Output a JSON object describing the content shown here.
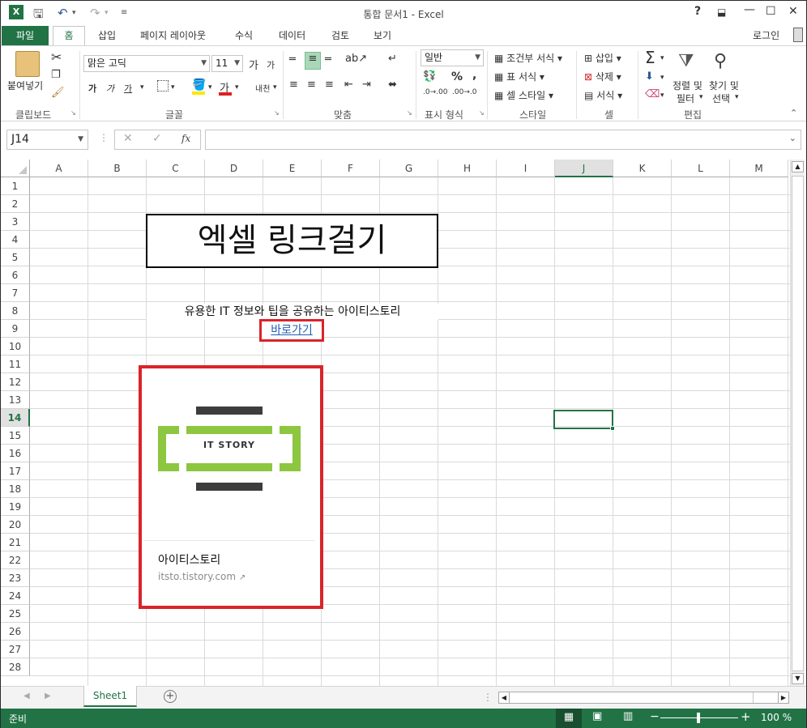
{
  "window": {
    "title": "통합 문서1 - Excel",
    "help": "?",
    "signin": "로그인"
  },
  "tabs": [
    "파일",
    "홈",
    "삽입",
    "페이지 레이아웃",
    "수식",
    "데이터",
    "검토",
    "보기"
  ],
  "ribbon": {
    "clipboard": {
      "paste": "붙여넣기",
      "label": "클립보드"
    },
    "font": {
      "name": "맑은 고딕",
      "size": "11",
      "grow": "가",
      "shrink": "가",
      "bold": "가",
      "italic": "가",
      "underline": "가",
      "color_a": "가",
      "phonetic": "내천",
      "label": "글꼴"
    },
    "align": {
      "label": "맞춤"
    },
    "number": {
      "format": "일반",
      "percent": "%",
      "comma": ",",
      "label": "표시 형식"
    },
    "styles": {
      "cond": "조건부 서식",
      "table": "표 서식",
      "cell": "셀 스타일",
      "label": "스타일"
    },
    "cells": {
      "insert": "삽입",
      "delete": "삭제",
      "format": "서식",
      "label": "셀"
    },
    "editing": {
      "sort": "정렬 및 필터",
      "sort1": "정렬 및",
      "sort2": "필터",
      "find1": "찾기 및",
      "find2": "선택",
      "label": "편집"
    }
  },
  "formula_bar": {
    "name_box": "J14",
    "fx": "fx",
    "value": ""
  },
  "columns": [
    "A",
    "B",
    "C",
    "D",
    "E",
    "F",
    "G",
    "H",
    "I",
    "J",
    "K",
    "L",
    "M"
  ],
  "rows": [
    "1",
    "2",
    "3",
    "4",
    "5",
    "6",
    "7",
    "8",
    "9",
    "10",
    "11",
    "12",
    "13",
    "14",
    "15",
    "16",
    "17",
    "18",
    "19",
    "20",
    "21",
    "22",
    "23",
    "24",
    "25",
    "26",
    "27",
    "28"
  ],
  "selected_cell": "J14",
  "content": {
    "title_text": "엑셀 링크걸기",
    "desc_text": "유용한 IT 정보와 팁을 공유하는 아이티스토리",
    "link_text": "바로가기",
    "card": {
      "logo_text": "IT STORY",
      "name": "아이티스토리",
      "url": "itsto.tistory.com"
    }
  },
  "sheet": {
    "tab": "Sheet1"
  },
  "status": {
    "ready": "준비",
    "zoom": "100 %"
  },
  "colors": {
    "accent": "#217346",
    "highlight": "#d9242b",
    "logo_green": "#8dc63f",
    "logo_dark": "#3d3d3d",
    "link": "#1f5fb4"
  }
}
